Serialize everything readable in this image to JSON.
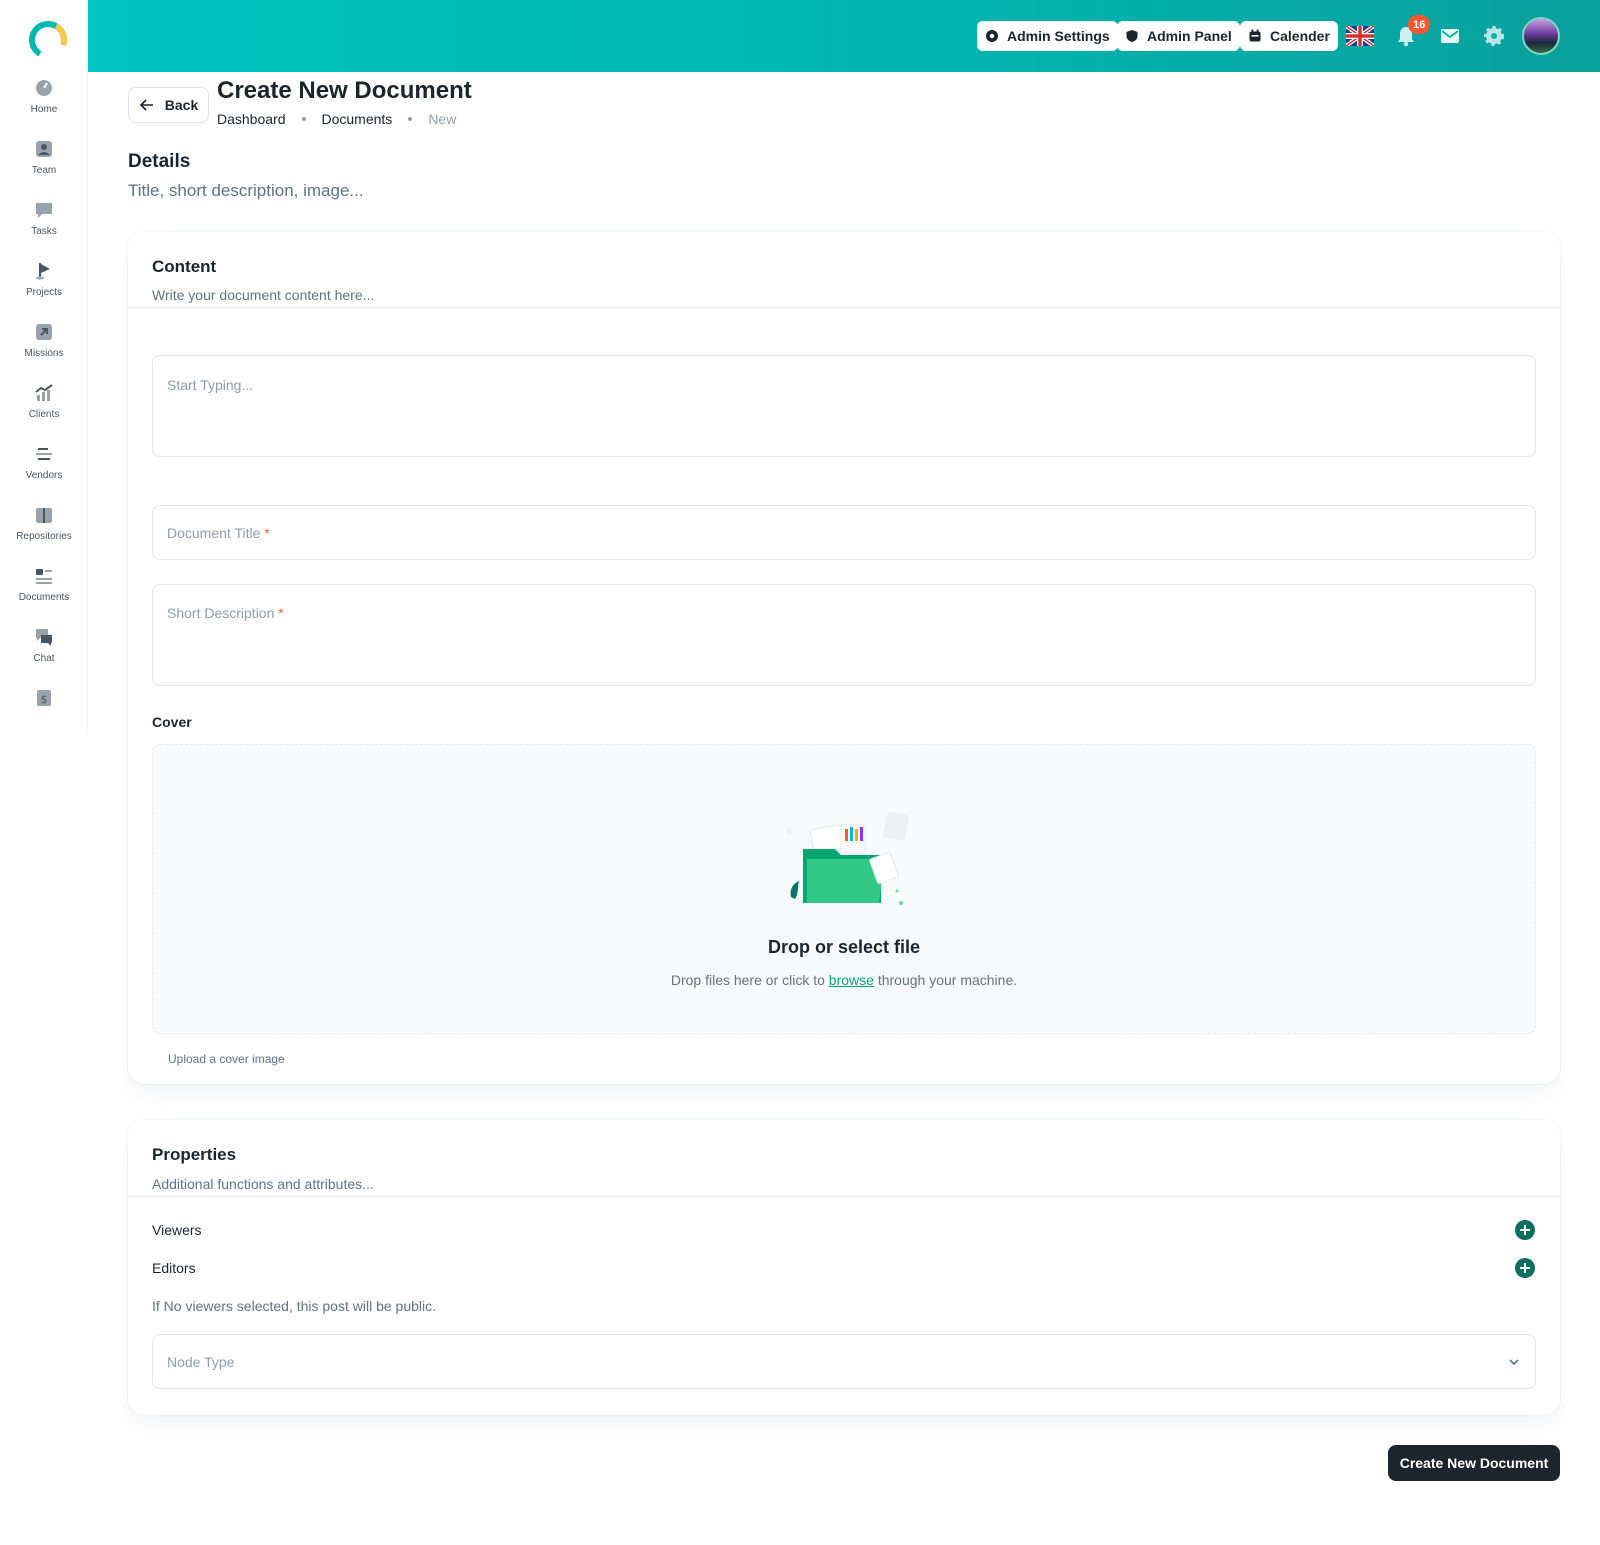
{
  "sidebar": {
    "items": [
      {
        "label": "Home",
        "icon": "dashboard-gauge-icon"
      },
      {
        "label": "Team",
        "icon": "user-icon"
      },
      {
        "label": "Tasks",
        "icon": "message-square-icon"
      },
      {
        "label": "Projects",
        "icon": "flag-icon"
      },
      {
        "label": "Missions",
        "icon": "arrow-up-right-icon"
      },
      {
        "label": "Clients",
        "icon": "chart-trend-icon"
      },
      {
        "label": "Vendors",
        "icon": "menu-lines-icon"
      },
      {
        "label": "Repositories",
        "icon": "folder-icon"
      },
      {
        "label": "Documents",
        "icon": "document-list-icon"
      },
      {
        "label": "Chat",
        "icon": "chat-icon"
      },
      {
        "label": "",
        "icon": "invoice-dollar-icon"
      }
    ]
  },
  "header": {
    "admin_settings": "Admin Settings",
    "admin_panel": "Admin Panel",
    "calendar": "Calender",
    "notification_count": "16"
  },
  "page": {
    "back": "Back",
    "title": "Create New Document",
    "breadcrumb": [
      "Dashboard",
      "Documents",
      "New"
    ]
  },
  "details": {
    "title": "Details",
    "subtitle": "Title, short description, image..."
  },
  "content_card": {
    "title": "Content",
    "subtitle": "Write your document content here...",
    "editor_placeholder": "Start Typing...",
    "doc_title_placeholder": "Document Title",
    "short_desc_placeholder": "Short Description",
    "required_mark": "*",
    "cover_label": "Cover",
    "dropzone_title": "Drop or select file",
    "dropzone_pre": "Drop files here or click to",
    "dropzone_link": "browse",
    "dropzone_post": "through your machine.",
    "helper": "Upload a cover image"
  },
  "properties_card": {
    "title": "Properties",
    "subtitle": "Additional functions and attributes...",
    "viewers": "Viewers",
    "editors": "Editors",
    "note": "If No viewers selected, this post will be public.",
    "node_type_placeholder": "Node Type"
  },
  "submit": "Create New Document",
  "colors": {
    "header_start": "#00c4c0",
    "header_end": "#0aa09c",
    "primary_dark": "#1c252e",
    "accent_green": "#00a76f",
    "plus_button": "#0b6e5f",
    "badge": "#ff5630"
  }
}
